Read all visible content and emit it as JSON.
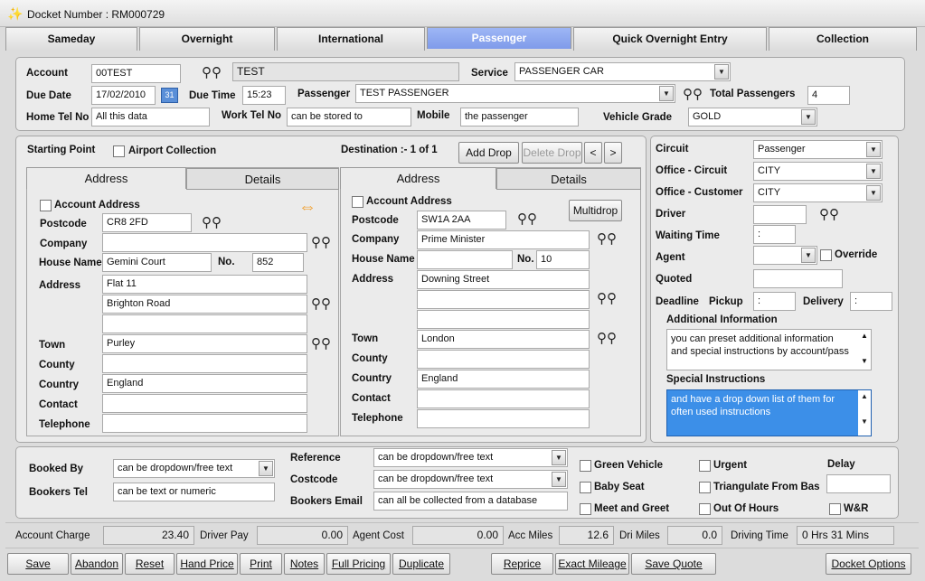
{
  "window": {
    "title": "Docket Number : RM000729"
  },
  "tabs": [
    "Sameday",
    "Overnight",
    "International",
    "Passenger",
    "Quick Overnight Entry",
    "Collection"
  ],
  "header": {
    "account_label": "Account",
    "account_value": "00TEST",
    "account_name": "TEST",
    "service_label": "Service",
    "service_value": "PASSENGER CAR",
    "due_date_label": "Due Date",
    "due_date_value": "17/02/2010",
    "due_time_label": "Due Time",
    "due_time_value": "15:23",
    "passenger_label": "Passenger",
    "passenger_value": "TEST PASSENGER",
    "total_passengers_label": "Total Passengers",
    "total_passengers_value": "4",
    "home_tel_label": "Home Tel No",
    "home_tel_value": "All this data",
    "work_tel_label": "Work Tel No",
    "work_tel_value": "can be stored to",
    "mobile_label": "Mobile",
    "mobile_value": "the passenger",
    "vehicle_grade_label": "Vehicle Grade",
    "vehicle_grade_value": "GOLD"
  },
  "route": {
    "starting_point_label": "Starting Point",
    "airport_collection_label": "Airport Collection",
    "destination_label": "Destination :- 1 of 1",
    "add_drop": "Add Drop",
    "delete_drop": "Delete Drop",
    "prev": "<",
    "next": ">",
    "multidrop": "Multidrop",
    "address_tab": "Address",
    "details_tab": "Details",
    "account_address_label": "Account Address",
    "labels": {
      "postcode": "Postcode",
      "company": "Company",
      "house_name": "House Name",
      "no": "No.",
      "address": "Address",
      "town": "Town",
      "county": "County",
      "country": "Country",
      "contact": "Contact",
      "telephone": "Telephone"
    },
    "start": {
      "postcode": "CR8 2FD",
      "company": "",
      "house_name": "Gemini Court",
      "no": "852",
      "address1": "Flat 11",
      "address2": "Brighton Road",
      "address3": "",
      "town": "Purley",
      "county": "",
      "country": "England",
      "contact": "",
      "telephone": ""
    },
    "dest": {
      "postcode": "SW1A 2AA",
      "company": "Prime Minister",
      "house_name": "",
      "no": "10",
      "address1": "Downing Street",
      "address2": "",
      "address3": "",
      "town": "London",
      "county": "",
      "country": "England",
      "contact": "",
      "telephone": ""
    }
  },
  "right": {
    "circuit_label": "Circuit",
    "circuit_value": "Passenger",
    "office_circuit_label": "Office - Circuit",
    "office_circuit_value": "CITY",
    "office_customer_label": "Office - Customer",
    "office_customer_value": "CITY",
    "driver_label": "Driver",
    "driver_value": "",
    "waiting_time_label": "Waiting Time",
    "waiting_time_value": ":",
    "agent_label": "Agent",
    "agent_value": "",
    "override_label": "Override",
    "quoted_label": "Quoted",
    "quoted_value": "",
    "deadline_label": "Deadline",
    "pickup_label": "Pickup",
    "pickup_value": ":",
    "delivery_label": "Delivery",
    "delivery_value": ":",
    "additional_info_label": "Additional Information",
    "additional_info_text": "you can preset additional information and special instructions by account/pass",
    "special_instructions_label": "Special Instructions",
    "special_instructions_text": "and have a drop down list of them for often used instructions"
  },
  "booking": {
    "booked_by_label": "Booked By",
    "booked_by_value": "can be dropdown/free text",
    "bookers_tel_label": "Bookers Tel",
    "bookers_tel_value": "can be text or numeric",
    "reference_label": "Reference",
    "reference_value": "can be dropdown/free text",
    "costcode_label": "Costcode",
    "costcode_value": "can be dropdown/free text",
    "bookers_email_label": "Bookers Email",
    "bookers_email_value": "can all be collected from a database",
    "green_vehicle": "Green Vehicle",
    "baby_seat": "Baby Seat",
    "meet_and_greet": "Meet and Greet",
    "urgent": "Urgent",
    "triangulate": "Triangulate From Bas",
    "out_of_hours": "Out Of Hours",
    "delay_label": "Delay",
    "delay_value": "",
    "wr": "W&R"
  },
  "totals": {
    "account_charge_label": "Account Charge",
    "account_charge_value": "23.40",
    "driver_pay_label": "Driver Pay",
    "driver_pay_value": "0.00",
    "agent_cost_label": "Agent Cost",
    "agent_cost_value": "0.00",
    "acc_miles_label": "Acc Miles",
    "acc_miles_value": "12.6",
    "dri_miles_label": "Dri Miles",
    "dri_miles_value": "0.0",
    "driving_time_label": "Driving Time",
    "driving_time_value": "0 Hrs 31 Mins"
  },
  "buttons": [
    "Save",
    "Abandon",
    "Reset",
    "Hand Price",
    "Print",
    "Notes",
    "Full Pricing",
    "Duplicate",
    "Reprice",
    "Exact Mileage",
    "Save Quote",
    "Docket Options"
  ]
}
